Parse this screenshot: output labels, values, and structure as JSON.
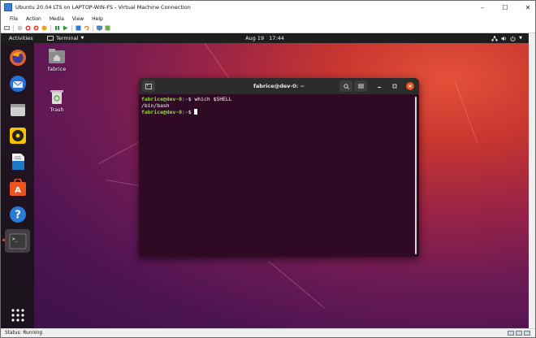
{
  "window": {
    "title": "Ubuntu 20.04 LTS on LAPTOP-WIN-FS - Virtual Machine Connection",
    "minimize": "–",
    "maximize": "☐",
    "close": "✕"
  },
  "menubar": {
    "items": [
      "File",
      "Action",
      "Media",
      "View",
      "Help"
    ]
  },
  "toolbar": {
    "buttons": [
      "ctrl-alt-del",
      "start",
      "turn-off",
      "shut-down",
      "save",
      "pause",
      "resume",
      "checkpoint",
      "revert",
      "enhanced-session",
      "share"
    ]
  },
  "gnome": {
    "activities": "Activities",
    "app_menu": "Terminal",
    "date": "Aug 19",
    "time": "17:44"
  },
  "dock": {
    "items": [
      "firefox",
      "thunderbird",
      "files",
      "rhythmbox",
      "libreoffice-writer",
      "ubuntu-software",
      "help",
      "terminal",
      "show-applications"
    ]
  },
  "desktop": {
    "home_label": "fabrice",
    "trash_label": "Trash"
  },
  "terminal": {
    "title": "fabrice@dev-0: ~",
    "lines": [
      {
        "user": "fabrice@dev-0",
        "sep": ":",
        "path": "~",
        "dollar": "$ ",
        "cmd": "which $SHELL"
      },
      {
        "output": "/bin/bash"
      },
      {
        "user": "fabrice@dev-0",
        "sep": ":",
        "path": "~",
        "dollar": "$ ",
        "cmd": ""
      }
    ]
  },
  "status": {
    "text": "Status: Running"
  },
  "colors": {
    "ubuntu_orange": "#e95420",
    "terminal_bg": "#300a24",
    "prompt_user": "#8ae234",
    "prompt_path": "#729fcf"
  }
}
